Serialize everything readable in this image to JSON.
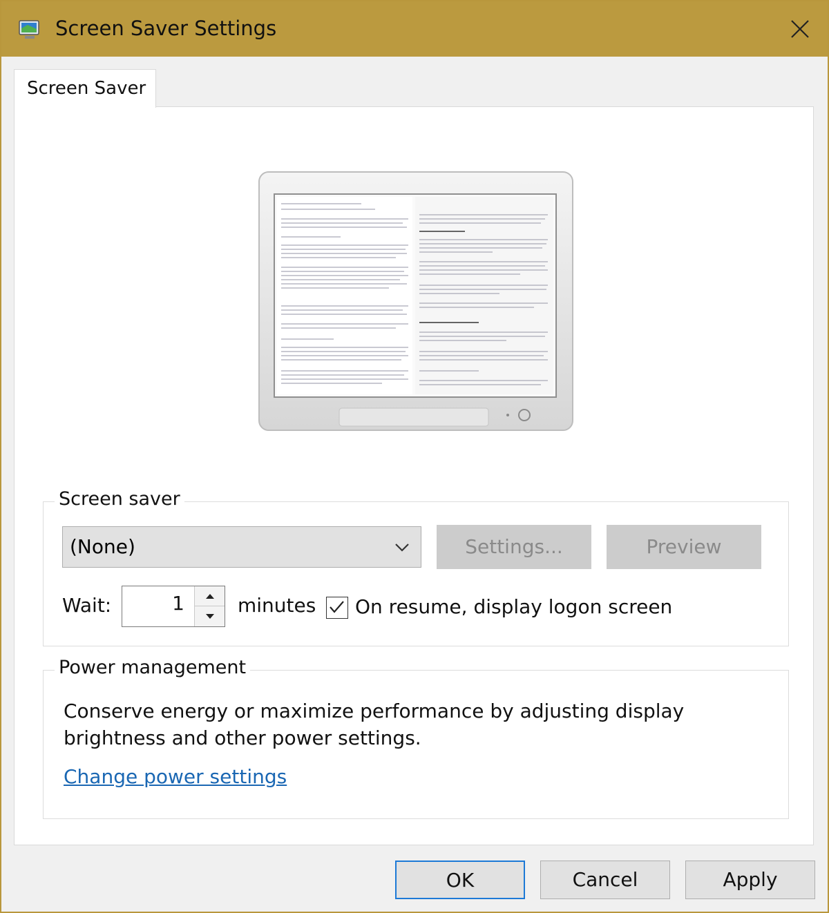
{
  "window": {
    "title": "Screen Saver Settings"
  },
  "tabs": [
    {
      "label": "Screen Saver"
    }
  ],
  "screen_saver_group": {
    "title": "Screen saver",
    "selected": "(None)",
    "settings_label": "Settings...",
    "preview_label": "Preview",
    "wait_label": "Wait:",
    "wait_value": "1",
    "minutes_label": "minutes",
    "logon_label": "On resume, display logon screen",
    "logon_checked": true
  },
  "power_group": {
    "title": "Power management",
    "description": "Conserve energy or maximize performance by adjusting display brightness and other power settings.",
    "link_label": "Change power settings"
  },
  "buttons": {
    "ok": "OK",
    "cancel": "Cancel",
    "apply": "Apply"
  },
  "colors": {
    "titlebar": "#bb9a3f",
    "link": "#1a67b3",
    "focus": "#1c79d6"
  }
}
